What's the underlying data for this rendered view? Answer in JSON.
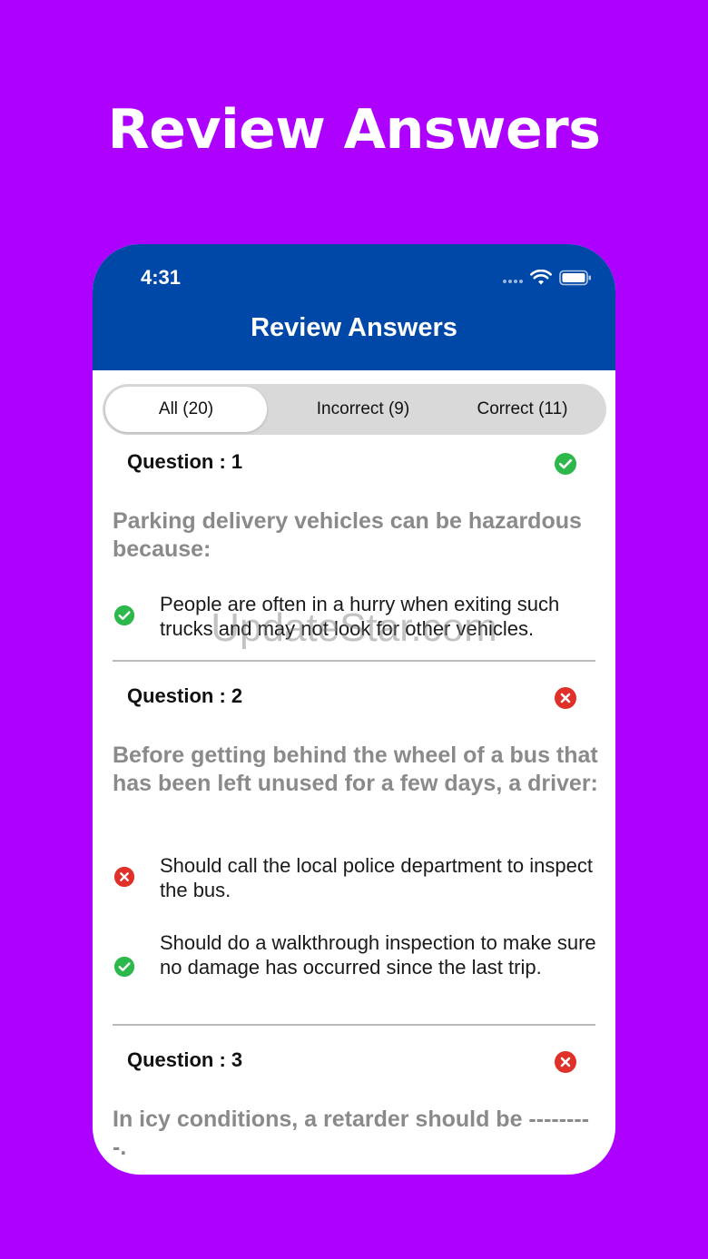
{
  "promo_title": "Review Answers",
  "status_bar": {
    "time": "4:31"
  },
  "app_bar": {
    "title": "Review Answers"
  },
  "tabs": [
    {
      "label": "All (20)",
      "active": true
    },
    {
      "label": "Incorrect (9)",
      "active": false
    },
    {
      "label": "Correct (11)",
      "active": false
    }
  ],
  "questions": [
    {
      "header": "Question : 1",
      "status": "correct",
      "text": "Parking delivery vehicles can be hazardous because:",
      "options": [
        {
          "text": "People are often in a hurry when exiting such trucks and may not look for other vehicles.",
          "status": "correct"
        }
      ]
    },
    {
      "header": "Question : 2",
      "status": "incorrect",
      "text": "Before getting behind the wheel of a bus that has been left unused for a few days, a driver:",
      "options": [
        {
          "text": "Should call the local police department to inspect the bus.",
          "status": "incorrect"
        },
        {
          "text": "Should do a walkthrough inspection to make sure no damage has occurred since the last trip.",
          "status": "correct"
        }
      ]
    },
    {
      "header": "Question : 3",
      "status": "incorrect",
      "text": "In icy conditions, a retarder should be ---------."
    }
  ],
  "watermark": "UpdateStar.com",
  "colors": {
    "background": "#ad00fe",
    "app_bar": "#0048a8",
    "correct": "#2db84b",
    "incorrect": "#e0302a"
  }
}
